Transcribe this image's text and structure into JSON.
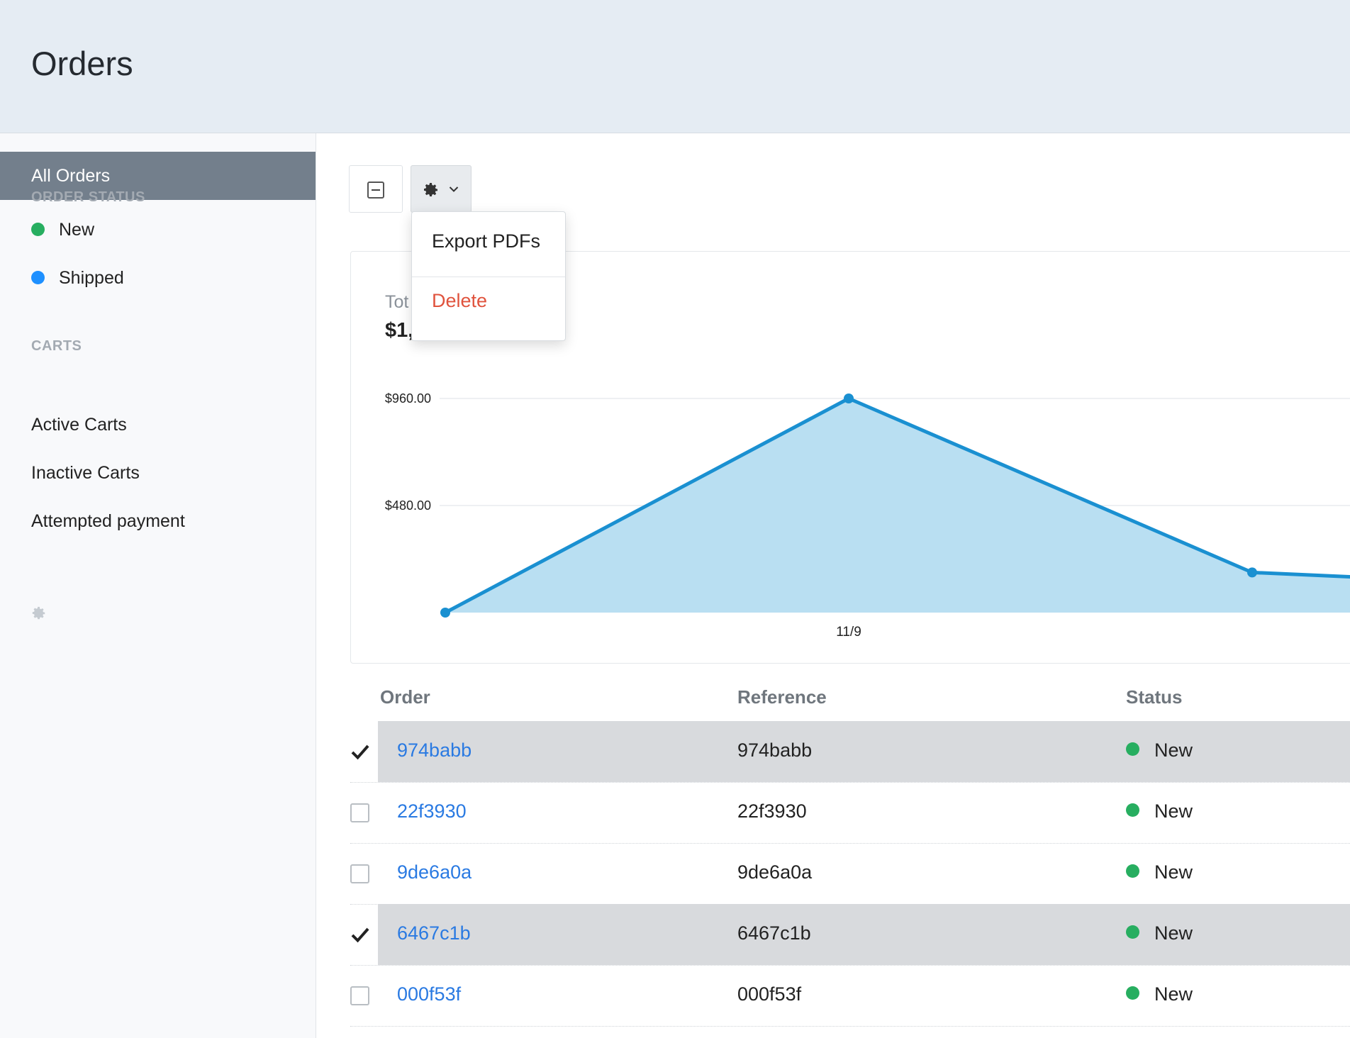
{
  "header": {
    "title": "Orders"
  },
  "sidebar": {
    "active_item": "All Orders",
    "sections": [
      {
        "heading": "ORDER STATUS",
        "items": [
          {
            "label": "New",
            "dot_color": "#27ae60"
          },
          {
            "label": "Shipped",
            "dot_color": "#1e90ff"
          }
        ]
      },
      {
        "heading": "CARTS",
        "items": [
          {
            "label": "Active Carts"
          },
          {
            "label": "Inactive Carts"
          },
          {
            "label": "Attempted payment"
          }
        ]
      }
    ],
    "settings_icon": "gear-icon"
  },
  "toolbar": {
    "collapse_icon": "minus-square-icon",
    "actions_icon": "gear-icon",
    "actions_dropdown": [
      "Export PDFs",
      "Delete"
    ]
  },
  "stats": {
    "label": "Tot",
    "value": "$1,"
  },
  "chart_data": {
    "type": "area",
    "x_tick_labels": [
      "11/9"
    ],
    "y_tick_labels": [
      "$960.00",
      "$480.00"
    ],
    "points": [
      {
        "x": 0,
        "y": 0
      },
      {
        "x": 1,
        "y": 960
      },
      {
        "x": 2,
        "y": 180
      },
      {
        "x": 2.5,
        "y": 140
      }
    ],
    "ylim": [
      0,
      960
    ],
    "line_color": "#1a90d1",
    "fill_color": "#b9dff2",
    "grid": true
  },
  "table": {
    "columns": [
      "Order",
      "Reference",
      "Status"
    ],
    "rows": [
      {
        "order": "974babb",
        "reference": "974babb",
        "status": "New",
        "checked": true
      },
      {
        "order": "22f3930",
        "reference": "22f3930",
        "status": "New",
        "checked": false
      },
      {
        "order": "9de6a0a",
        "reference": "9de6a0a",
        "status": "New",
        "checked": false
      },
      {
        "order": "6467c1b",
        "reference": "6467c1b",
        "status": "New",
        "checked": true
      },
      {
        "order": "000f53f",
        "reference": "000f53f",
        "status": "New",
        "checked": false
      }
    ]
  },
  "colors": {
    "accent": "#2a7ae2",
    "danger": "#e0533d",
    "status_new": "#27ae60",
    "status_shipped": "#1e90ff"
  }
}
